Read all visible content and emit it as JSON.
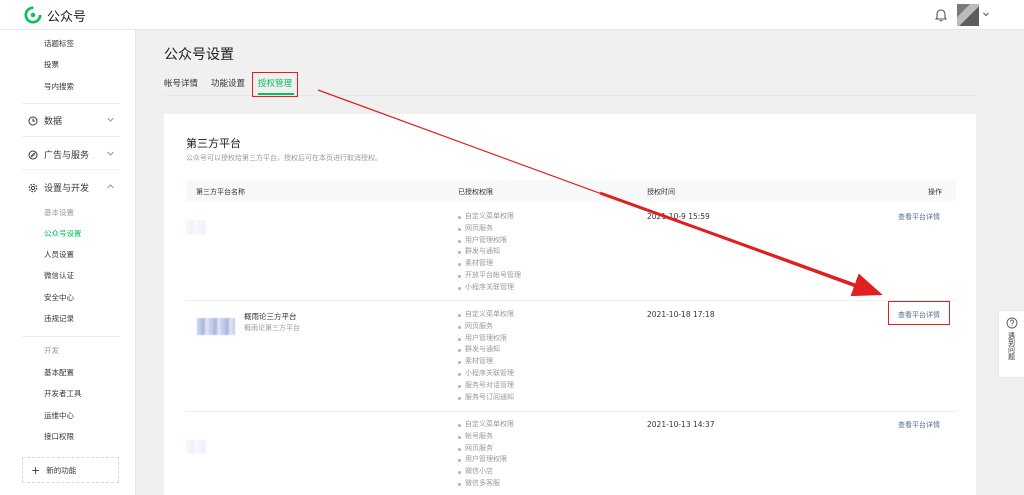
{
  "app": {
    "name": "公众号"
  },
  "sidebar": {
    "top_items": [
      "话题标签",
      "投票",
      "号内搜索"
    ],
    "groups": [
      {
        "label": "数据",
        "icon": "clock-icon"
      },
      {
        "label": "广告与服务",
        "icon": "compass-icon"
      },
      {
        "label": "设置与开发",
        "icon": "gear-icon"
      }
    ],
    "settings_items": [
      "基本设置",
      "公众号设置",
      "人员设置",
      "微信认证",
      "安全中心",
      "违规记录"
    ],
    "settings_active": "公众号设置",
    "dev_header": "开发",
    "dev_items": [
      "基本配置",
      "开发者工具",
      "运维中心",
      "接口权限"
    ],
    "new_function": "新的功能"
  },
  "main": {
    "title": "公众号设置",
    "tabs": [
      "帐号详情",
      "功能设置",
      "授权管理"
    ],
    "active_tab": "授权管理"
  },
  "card": {
    "title": "第三方平台",
    "description": "公众号可以授权给第三方平台，授权后可在本页进行取消授权。",
    "columns": [
      "第三方平台名称",
      "已授权权限",
      "授权时间",
      "操作"
    ],
    "rows": [
      {
        "name": "",
        "subname": "",
        "permissions": [
          "自定义菜单权限",
          "网页服务",
          "用户管理权限",
          "群发与通知",
          "素材管理",
          "开放平台帐号管理",
          "小程序关联管理"
        ],
        "time": "2021-10-9 15:59",
        "action": "查看平台详情"
      },
      {
        "name": "概雨论三方平台",
        "subname": "概雨论第三方平台",
        "permissions": [
          "自定义菜单权限",
          "网页服务",
          "用户管理权限",
          "群发与通知",
          "素材管理",
          "小程序关联管理",
          "服务号对话管理",
          "服务号订阅通知"
        ],
        "time": "2021-10-18 17:18",
        "action": "查看平台详情"
      },
      {
        "name": "",
        "subname": "",
        "permissions": [
          "自定义菜单权限",
          "帐号服务",
          "网页服务",
          "用户管理权限",
          "微信小店",
          "微信多客服"
        ],
        "time": "2021-10-13 14:37",
        "action": "查看平台详情"
      }
    ]
  },
  "help": {
    "label": "遇到问题"
  },
  "colors": {
    "accent": "#07c160",
    "link": "#576b95",
    "annotation": "#e02020"
  }
}
